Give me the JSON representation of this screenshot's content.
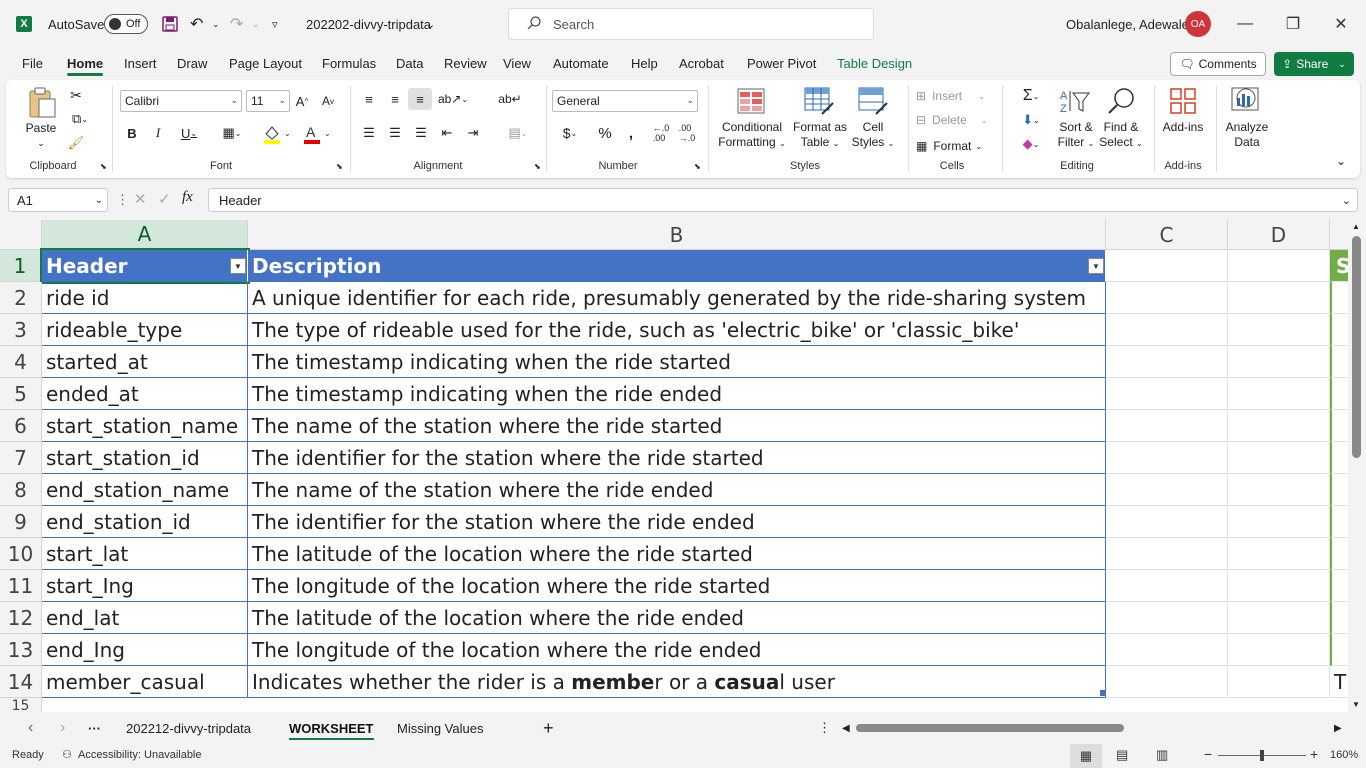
{
  "titlebar": {
    "app_icon": "X",
    "autosave_label": "AutoSave",
    "autosave_state": "Off",
    "filename": "202202-divvy-tripdata",
    "search_placeholder": "Search",
    "user_name": "Obalanlege, Adewale",
    "user_initials": "OA"
  },
  "tabs": [
    "File",
    "Home",
    "Insert",
    "Draw",
    "Page Layout",
    "Formulas",
    "Data",
    "Review",
    "View",
    "Automate",
    "Help",
    "Acrobat",
    "Power Pivot",
    "Table Design"
  ],
  "active_tab": "Home",
  "comments_label": "Comments",
  "share_label": "Share",
  "ribbon": {
    "clipboard": {
      "paste": "Paste",
      "label": "Clipboard"
    },
    "font": {
      "family": "Calibri",
      "size": "11",
      "label": "Font"
    },
    "alignment": {
      "label": "Alignment"
    },
    "number": {
      "format": "General",
      "label": "Number"
    },
    "styles": {
      "conditional": [
        "Conditional",
        "Formatting"
      ],
      "format_table": [
        "Format as",
        "Table"
      ],
      "cell_styles": [
        "Cell",
        "Styles"
      ],
      "label": "Styles"
    },
    "cells": {
      "insert": "Insert",
      "delete": "Delete",
      "format": "Format",
      "label": "Cells"
    },
    "editing": {
      "sort": [
        "Sort &",
        "Filter"
      ],
      "find": [
        "Find &",
        "Select"
      ],
      "label": "Editing"
    },
    "addins": {
      "addins": "Add-ins",
      "label": "Add-ins"
    },
    "analyze": [
      "Analyze",
      "Data"
    ]
  },
  "formula_bar": {
    "name_box": "A1",
    "fx": "fx",
    "content": "Header"
  },
  "columns": [
    "A",
    "B",
    "C",
    "D"
  ],
  "rows": [
    {
      "n": "1",
      "a": "Header",
      "b": "Description"
    },
    {
      "n": "2",
      "a": "ride id",
      "b": "A unique identifier for each ride, presumably generated by the ride-sharing system"
    },
    {
      "n": "3",
      "a": "rideable_type",
      "b": "The type of rideable used for the ride, such as 'electric_bike' or 'classic_bike'"
    },
    {
      "n": "4",
      "a": "started_at",
      "b": "The timestamp indicating when the ride started"
    },
    {
      "n": "5",
      "a": "ended_at",
      "b": "The timestamp indicating when the ride ended"
    },
    {
      "n": "6",
      "a": "start_station_name",
      "b": "The name of the station where the ride started"
    },
    {
      "n": "7",
      "a": "start_station_id",
      "b": "The identifier for the station where the ride started"
    },
    {
      "n": "8",
      "a": "end_station_name",
      "b": "The name of the station where the ride ended"
    },
    {
      "n": "9",
      "a": "end_station_id",
      "b": "The identifier for the station where the ride ended"
    },
    {
      "n": "10",
      "a": "start_lat",
      "b": "The latitude of the location where the ride started"
    },
    {
      "n": "11",
      "a": "start_Ing",
      "b": "The longitude of the location where the ride started"
    },
    {
      "n": "12",
      "a": "end_lat",
      "b": "The latitude of the location where the ride ended"
    },
    {
      "n": "13",
      "a": "end_Ing",
      "b": "The longitude of the location where the ride ended"
    },
    {
      "n": "14",
      "a": "member_casual",
      "b": ""
    }
  ],
  "row14_b": {
    "p1": "Indicates whether the rider is a ",
    "b1": "membe",
    "p2": "r or a ",
    "b2": "casua",
    "p3": "l user"
  },
  "row_15": "15",
  "edge_cells": {
    "row1": "S",
    "row14": "T"
  },
  "sheets": [
    "202212-divvy-tripdata",
    "WORKSHEET",
    "Missing Values"
  ],
  "active_sheet": "WORKSHEET",
  "status": {
    "ready": "Ready",
    "accessibility": "Accessibility: Unavailable",
    "zoom": "160%"
  },
  "colors": {
    "brand": "#107c41",
    "table_header": "#4472c4"
  }
}
